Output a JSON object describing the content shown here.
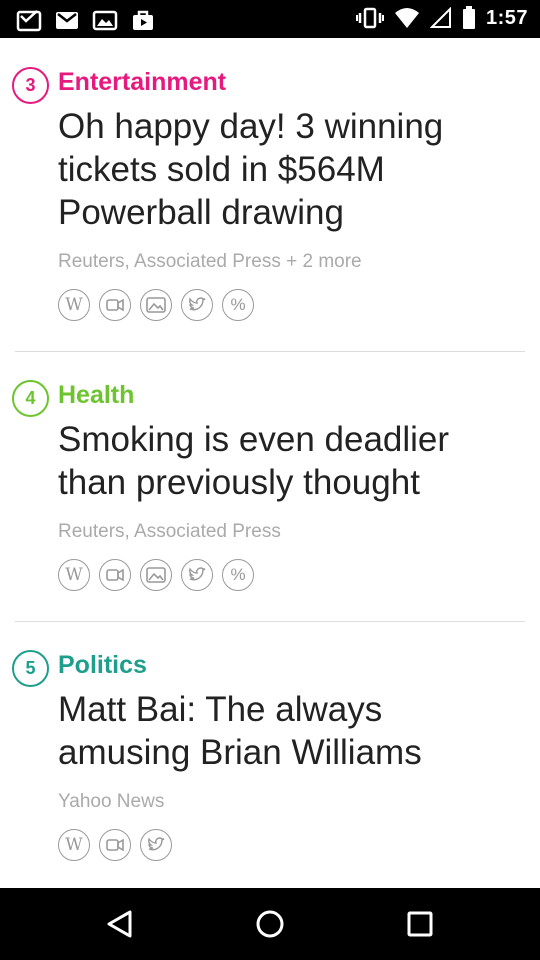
{
  "status_bar": {
    "time": "1:57",
    "left_icons": [
      "inbox-icon",
      "gmail-icon",
      "gallery-icon",
      "shopping-bag-icon"
    ],
    "right_icons": [
      "vibrate-icon",
      "wifi-icon",
      "signal-icon",
      "battery-icon"
    ]
  },
  "stories": [
    {
      "rank": "3",
      "category": "Entertainment",
      "color": "#e5197e",
      "headline": "Oh happy day! 3 winning tickets sold in $564M Powerball drawing",
      "sources": "Reuters, Associated Press + 2 more",
      "icons": [
        "wikipedia-icon",
        "video-icon",
        "photo-icon",
        "twitter-icon",
        "percent-icon"
      ]
    },
    {
      "rank": "4",
      "category": "Health",
      "color": "#6dc42f",
      "headline": "Smoking is even deadlier than previously thought",
      "sources": "Reuters, Associated Press",
      "icons": [
        "wikipedia-icon",
        "video-icon",
        "photo-icon",
        "twitter-icon",
        "percent-icon"
      ]
    },
    {
      "rank": "5",
      "category": "Politics",
      "color": "#1e9e8c",
      "headline": "Matt Bai: The always amusing Brian Williams",
      "sources": "Yahoo News",
      "icons": [
        "wikipedia-icon",
        "video-icon",
        "twitter-icon"
      ]
    }
  ],
  "nav_bar": {
    "buttons": [
      "back-icon",
      "home-icon",
      "recents-icon"
    ]
  }
}
